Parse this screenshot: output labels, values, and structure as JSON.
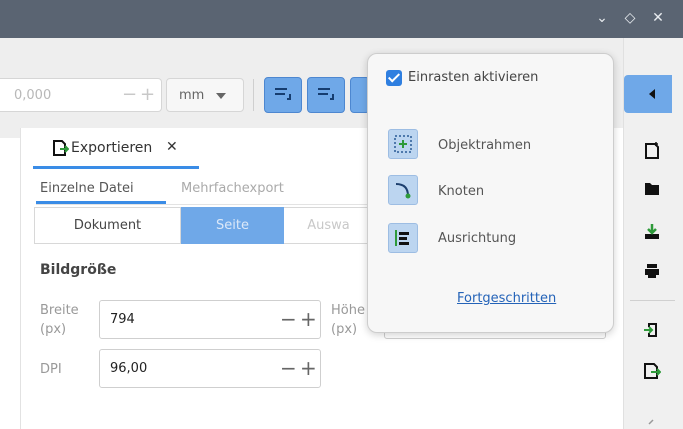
{
  "window": {
    "buttons": [
      {
        "icon": "chevron-down-icon",
        "glyph": "⌄"
      },
      {
        "icon": "restore-icon",
        "glyph": "◇"
      },
      {
        "icon": "close-icon",
        "glyph": "✕"
      }
    ]
  },
  "toolbar": {
    "value": "0,000",
    "minus": "−",
    "plus": "+",
    "unit": "mm",
    "snap_buttons": [
      "snap-bbox-icon",
      "snap-nodes-icon",
      "snap-align-icon"
    ]
  },
  "export": {
    "tab_label": "Exportieren",
    "tab_close": "✕",
    "subtabs": [
      "Einzelne Datei",
      "Mehrfachexport"
    ],
    "segments": [
      "Dokument",
      "Seite",
      "Auswa"
    ],
    "section_title": "Bildgröße",
    "width_label_1": "Breite",
    "width_label_2": "(px)",
    "width_value": "794",
    "height_label_1": "Höhe",
    "height_label_2": "(px)",
    "dpi_label": "DPI",
    "dpi_value": "96,00",
    "minus": "−",
    "plus": "+"
  },
  "popover": {
    "enable_snapping": "Einrasten aktivieren",
    "enabled": true,
    "items": [
      "Objektrahmen",
      "Knoten",
      "Ausrichtung"
    ],
    "advanced_link": "Fortgeschritten"
  },
  "sidebar": {
    "icons": [
      "new-document-icon",
      "open-folder-icon",
      "import-icon",
      "print-icon",
      "import-file-icon",
      "export-icon",
      "more-icon"
    ]
  },
  "colors": {
    "accent": "#3a8ce6",
    "button_blue": "#6fa8e8",
    "titlebar": "#5a6472"
  }
}
